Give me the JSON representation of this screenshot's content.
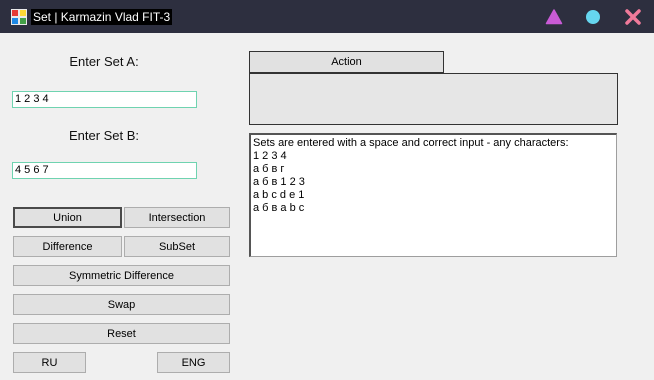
{
  "window": {
    "title": "Set | Karmazin Vlad FIT-3",
    "controls": {
      "triangle": "#c95bd6",
      "circle": "#66d6ef",
      "close": "#f07a9a"
    }
  },
  "set_a": {
    "label": "Enter Set A:",
    "value": "1 2 3 4"
  },
  "set_b": {
    "label": "Enter Set B:",
    "value": "4 5 6 7"
  },
  "buttons": {
    "union": "Union",
    "intersection": "Intersection",
    "difference": "Difference",
    "subset": "SubSet",
    "symmetric_difference": "Symmetric Difference",
    "swap": "Swap",
    "reset": "Reset",
    "ru": "RU",
    "eng": "ENG",
    "action": "Action"
  },
  "info": {
    "lines": [
      "Sets are entered with a space and correct input - any characters:",
      "1 2 3 4",
      "а б в г",
      "а б в 1 2 3",
      "a b c d e 1",
      "а б в a b c"
    ]
  }
}
